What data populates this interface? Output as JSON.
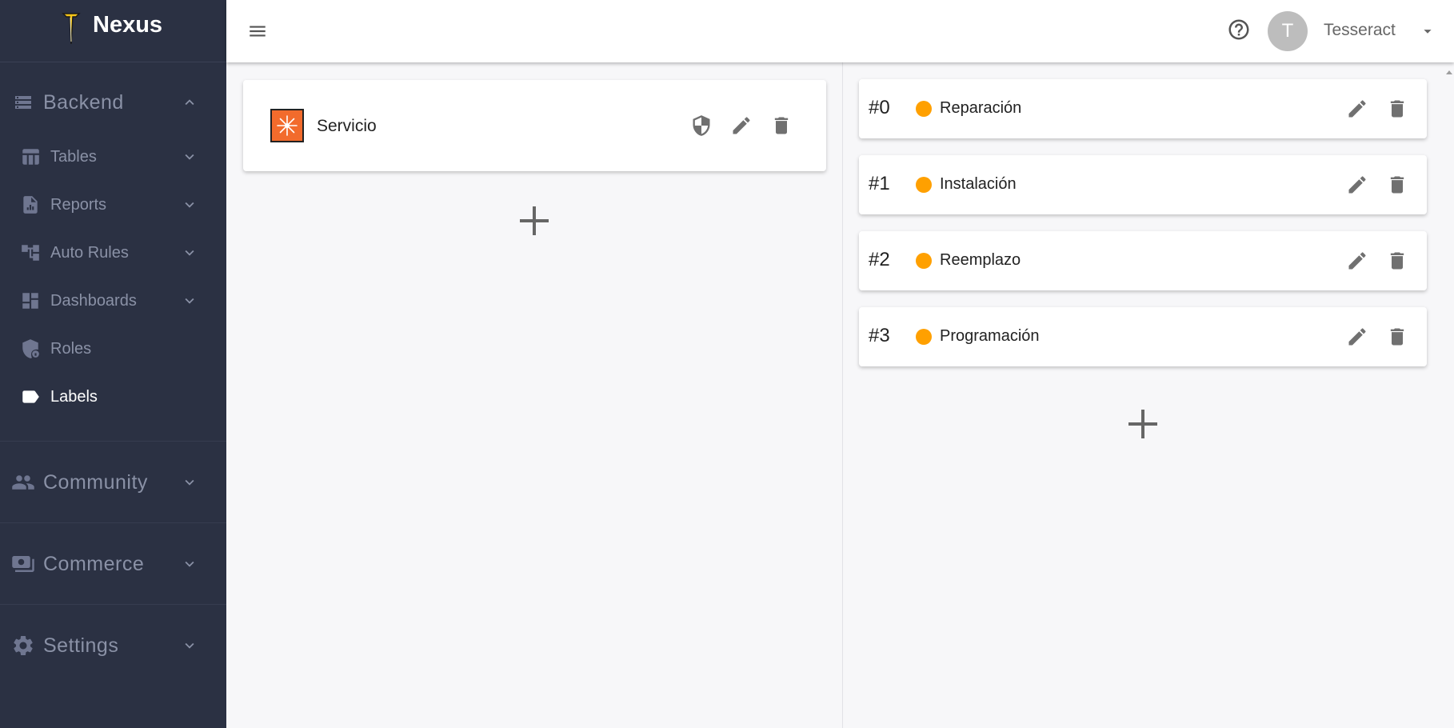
{
  "brand": {
    "name": "Nexus"
  },
  "sidebar": {
    "sections": [
      {
        "label": "Backend",
        "icon": "storage-icon",
        "expanded": true
      },
      {
        "label": "Community",
        "icon": "people-icon",
        "expanded": false
      },
      {
        "label": "Commerce",
        "icon": "payments-icon",
        "expanded": false
      },
      {
        "label": "Settings",
        "icon": "gear-icon",
        "expanded": false
      }
    ],
    "backend_items": [
      {
        "label": "Tables",
        "icon": "table-icon"
      },
      {
        "label": "Reports",
        "icon": "report-icon"
      },
      {
        "label": "Auto Rules",
        "icon": "flow-icon"
      },
      {
        "label": "Dashboards",
        "icon": "dashboard-icon"
      },
      {
        "label": "Roles",
        "icon": "shield-lock-icon"
      },
      {
        "label": "Labels",
        "icon": "label-icon",
        "active": true
      }
    ]
  },
  "topbar": {
    "user_initial": "T",
    "user_name": "Tesseract"
  },
  "categories": [
    {
      "name": "Servicio",
      "color": "#f26b2c"
    }
  ],
  "labels": [
    {
      "num": "#0",
      "name": "Reparación",
      "color": "#ffa000"
    },
    {
      "num": "#1",
      "name": "Instalación",
      "color": "#ffa000"
    },
    {
      "num": "#2",
      "name": "Reemplazo",
      "color": "#ffa000"
    },
    {
      "num": "#3",
      "name": "Programación",
      "color": "#ffa000"
    }
  ],
  "colors": {
    "sidebar_bg": "#2b3143",
    "sidebar_text": "#8a91a6",
    "active_text": "#ffffff",
    "icon_grey": "#707070"
  }
}
